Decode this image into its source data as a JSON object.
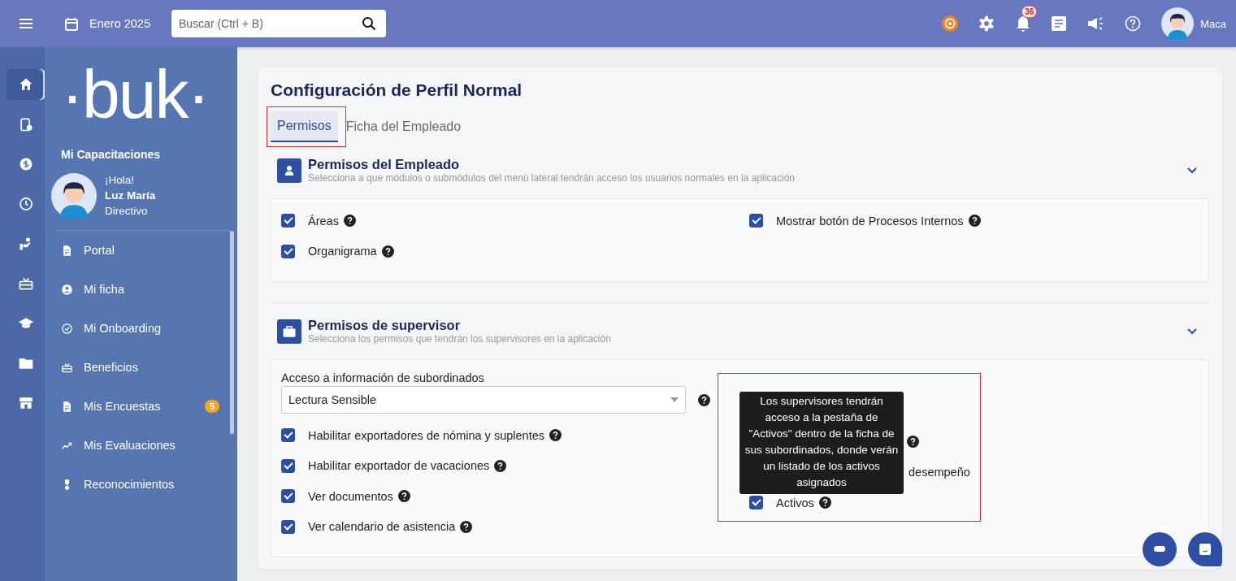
{
  "topbar": {
    "period": "Enero 2025",
    "search": {
      "placeholder": "Buscar (Ctrl + B)"
    },
    "notifications": "36",
    "user": "Maca"
  },
  "rail": [
    {
      "selected": true
    },
    {
      "selected": false
    },
    {
      "selected": false
    },
    {
      "selected": false
    },
    {
      "selected": false
    },
    {
      "selected": false
    },
    {
      "selected": false
    },
    {
      "selected": false
    },
    {
      "selected": false
    }
  ],
  "sidebar": {
    "logo": "·buk·",
    "module": "Mi Capacitaciones",
    "greeting": "¡Hola!",
    "name": "Luz María",
    "role": "Directivo",
    "items": [
      {
        "label": "Portal"
      },
      {
        "label": "Mi ficha"
      },
      {
        "label": "Mi Onboarding"
      },
      {
        "label": "Beneficios"
      },
      {
        "label": "Mis Encuestas",
        "badge": "5"
      },
      {
        "label": "Mis Evaluaciones"
      },
      {
        "label": "Reconocimientos"
      }
    ]
  },
  "page": {
    "title": "Configuración de Perfil Normal",
    "tabs": [
      {
        "label": "Permisos",
        "selected": true
      },
      {
        "label": "Ficha del Empleado",
        "selected": false
      }
    ],
    "sections": [
      {
        "title": "Permisos del Empleado",
        "subtitle": "Selecciona a que módulos o submódulos del menú lateral tendrán acceso los usuarios normales en la aplicación",
        "left": [
          {
            "kind": "full",
            "label": "Áreas",
            "checked": true
          },
          {
            "kind": "full",
            "label": "Organigrama",
            "checked": true
          }
        ],
        "right": [
          {
            "kind": "full",
            "label": "Mostrar botón de Procesos Internos",
            "checked": true
          }
        ]
      },
      {
        "title": "Permisos de supervisor",
        "subtitle": "Selecciona los permisos que tendrán los supervisores en la aplicación",
        "select": {
          "label": "Acceso a información de subordinados",
          "value": "Lectura Sensible"
        },
        "left": [
          {
            "kind": "full",
            "label": "Habilitar exportadores de nómina y suplentes",
            "checked": true
          },
          {
            "kind": "full",
            "label": "Habilitar exportador de vacaciones",
            "checked": true
          },
          {
            "kind": "full",
            "label": "Ver documentos",
            "checked": true
          },
          {
            "kind": "full",
            "label": "Ver calendario de asistencia",
            "checked": true
          }
        ],
        "right": [
          {
            "kind": "covered"
          },
          {
            "kind": "partial",
            "label": "desempeño"
          },
          {
            "kind": "full",
            "label": "Activos",
            "checked": true,
            "tooltip": "Los supervisores tendrán acceso a la pestaña de \"Activos\" dentro de la ficha de sus subordinados, donde verán un listado de los activos asignados"
          }
        ]
      }
    ]
  }
}
